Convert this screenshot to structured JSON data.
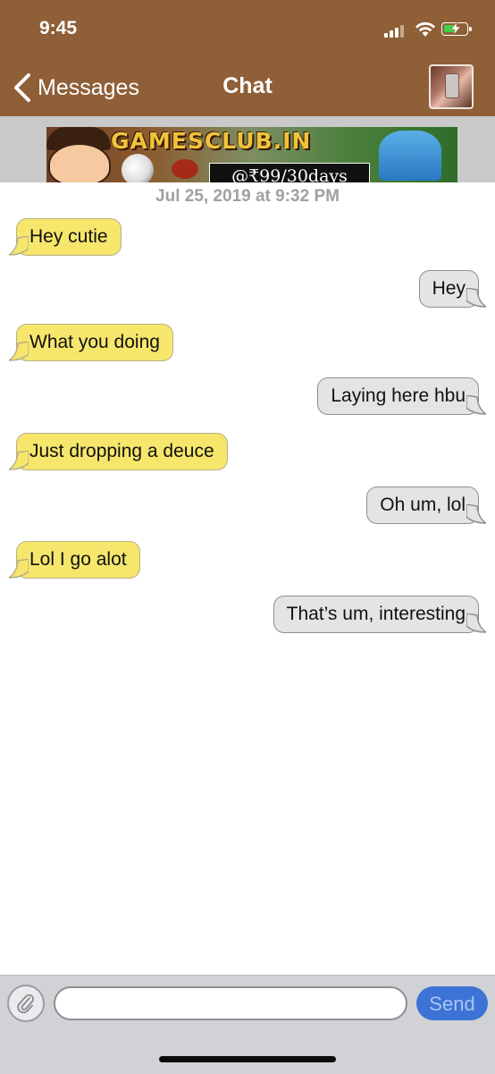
{
  "status_bar": {
    "time": "9:45",
    "battery_color": "#3cd34a"
  },
  "nav": {
    "back_label": "Messages",
    "title": "Chat",
    "bar_color": "#8f5f37"
  },
  "ad": {
    "logo_text": "GAMESCLUB.IN",
    "price_text": "@₹99/30days"
  },
  "conversation": {
    "timestamp": "Jul 25, 2019 at 9:32 PM",
    "incoming_color": "#f6e66c",
    "outgoing_color": "#e4e4e6",
    "messages": [
      {
        "direction": "incoming",
        "text": "Hey cutie"
      },
      {
        "direction": "outgoing",
        "text": "Hey"
      },
      {
        "direction": "incoming",
        "text": "What you doing"
      },
      {
        "direction": "outgoing",
        "text": "Laying here hbu"
      },
      {
        "direction": "incoming",
        "text": "Just dropping a deuce"
      },
      {
        "direction": "outgoing",
        "text": "Oh um, lol"
      },
      {
        "direction": "incoming",
        "text": "Lol I go alot"
      },
      {
        "direction": "outgoing",
        "text": "That’s um, interesting"
      }
    ]
  },
  "composer": {
    "input_value": "",
    "input_placeholder": "",
    "send_label": "Send",
    "attach_icon": "paperclip-icon",
    "send_color": "#3c73d4"
  }
}
